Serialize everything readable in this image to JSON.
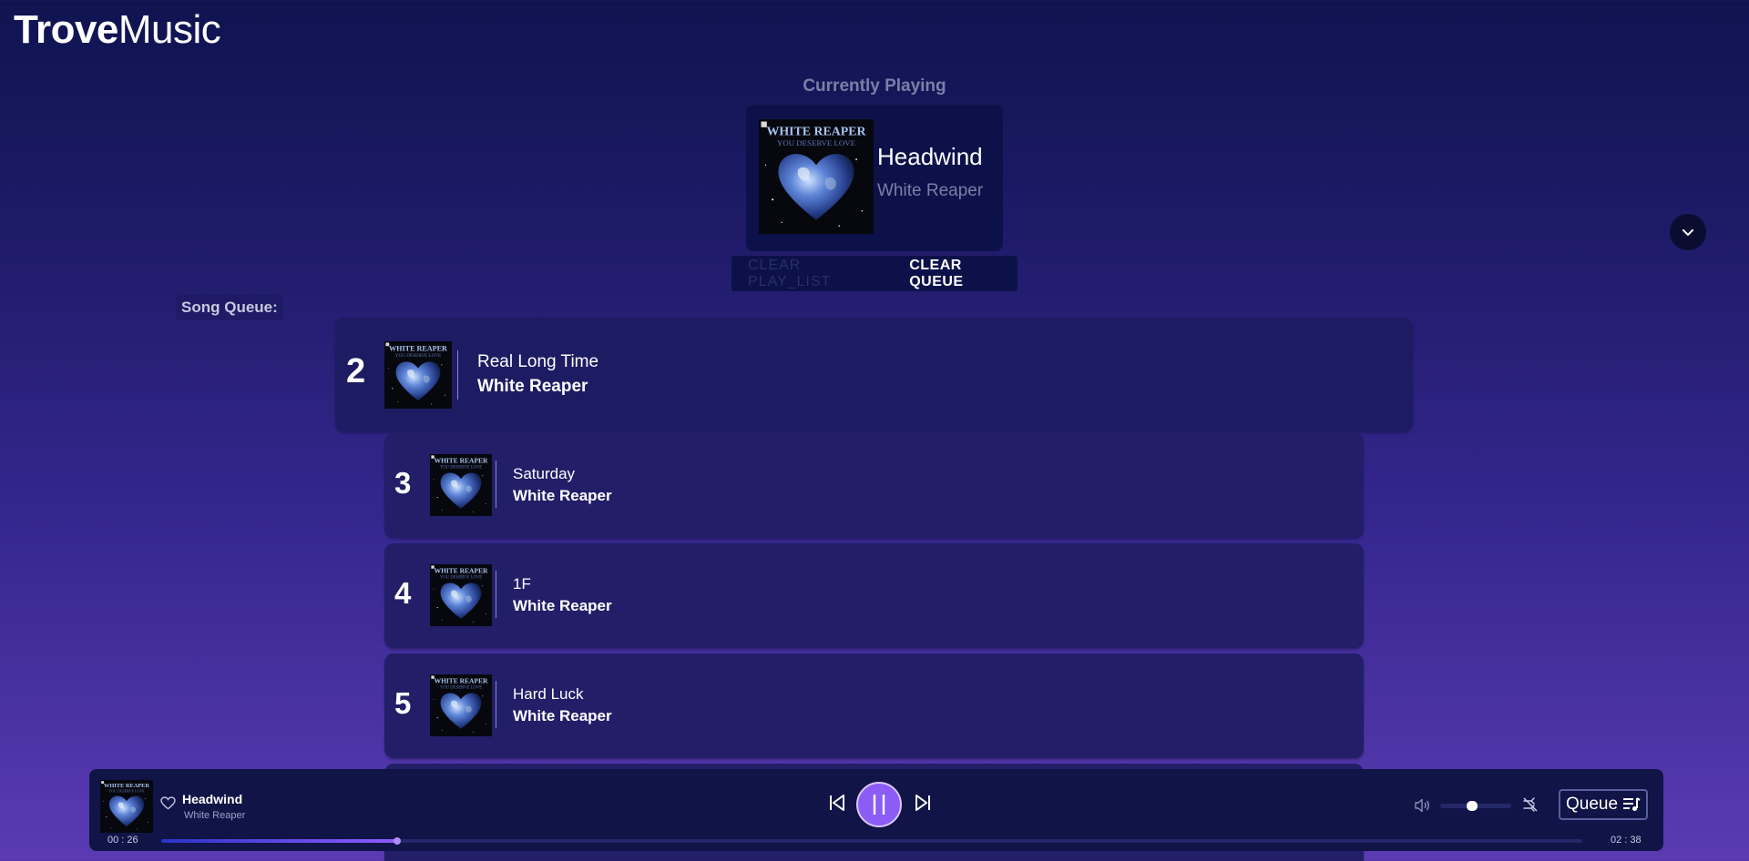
{
  "app": {
    "logo_bold": "Trove",
    "logo_thin": "Music"
  },
  "now_playing": {
    "label": "Currently Playing",
    "title": "Headwind",
    "artist": "White Reaper",
    "cover_title": "WHITE REAPER",
    "cover_subtitle": "YOU DESERVE LOVE"
  },
  "actions": {
    "clear_playlist": "CLEAR PLAY_LIST",
    "clear_queue": "CLEAR QUEUE"
  },
  "queue": {
    "label": "Song Queue:",
    "items": [
      {
        "num": "2",
        "title": "Real Long Time",
        "artist": "White Reaper"
      },
      {
        "num": "3",
        "title": "Saturday",
        "artist": "White Reaper"
      },
      {
        "num": "4",
        "title": "1F",
        "artist": "White Reaper"
      },
      {
        "num": "5",
        "title": "Hard Luck",
        "artist": "White Reaper"
      }
    ]
  },
  "player": {
    "title": "Headwind",
    "artist": "White Reaper",
    "current_time": "00 : 26",
    "total_time": "02 : 38",
    "progress": 0.166,
    "volume": 0.45,
    "queue_label": "Queue",
    "icons": [
      "heart-icon",
      "previous-icon",
      "pause-icon",
      "next-icon",
      "volume-icon",
      "shuffle-off-icon",
      "queue-list-icon",
      "chevron-down-icon"
    ]
  },
  "colors": {
    "accent": "#8b5cf6",
    "panel": "#101446",
    "row": "#221e68",
    "muted": "#7a7fa6"
  }
}
